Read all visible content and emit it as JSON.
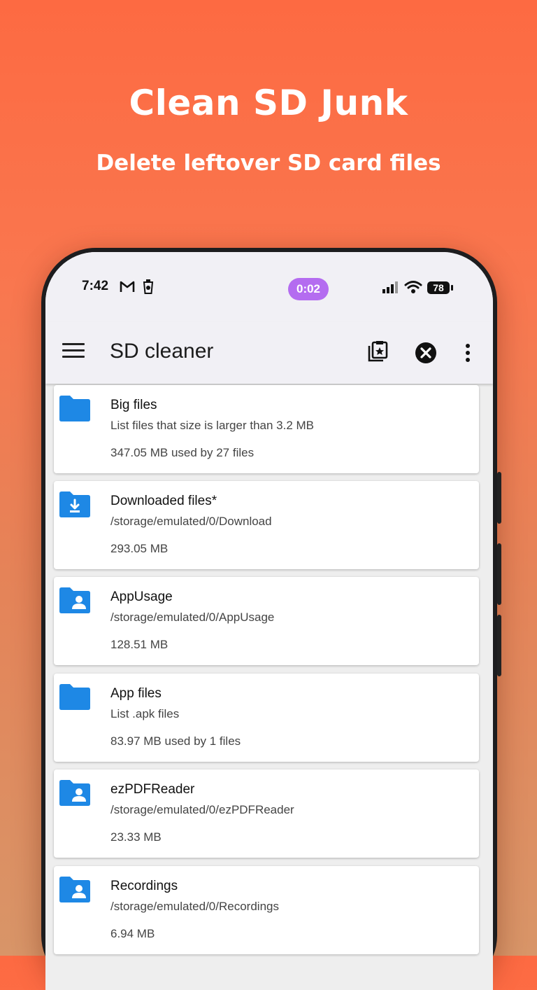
{
  "promo": {
    "title": "Clean SD Junk",
    "subtitle": "Delete leftover SD card files"
  },
  "status_bar": {
    "time": "7:42",
    "notification_icons": [
      "gmail-icon",
      "cleaner-icon"
    ],
    "timer": "0:02",
    "battery": "78",
    "timer_color": "#B46CF0"
  },
  "app_bar": {
    "title": "SD cleaner",
    "actions": [
      "gallery-star-icon",
      "close-circle-icon",
      "more-vert-icon"
    ]
  },
  "items": [
    {
      "title": "Big files",
      "path": "List files that size is larger than 3.2 MB",
      "size": "347.05 MB used by 27 files",
      "icon": "folder-icon"
    },
    {
      "title": "Downloaded files*",
      "path": "/storage/emulated/0/Download",
      "size": "293.05 MB",
      "icon": "download-folder-icon"
    },
    {
      "title": "AppUsage",
      "path": "/storage/emulated/0/AppUsage",
      "size": "128.51 MB",
      "icon": "user-folder-icon"
    },
    {
      "title": "App files",
      "path": "List .apk files",
      "size": "83.97 MB used by 1 files",
      "icon": "folder-icon"
    },
    {
      "title": "ezPDFReader",
      "path": "/storage/emulated/0/ezPDFReader",
      "size": "23.33 MB",
      "icon": "user-folder-icon"
    },
    {
      "title": "Recordings",
      "path": "/storage/emulated/0/Recordings",
      "size": "6.94 MB",
      "icon": "user-folder-icon"
    }
  ],
  "colors": {
    "accent": "#1E88E5",
    "background_top": "#FD6A42",
    "background_bottom": "#D89568"
  }
}
